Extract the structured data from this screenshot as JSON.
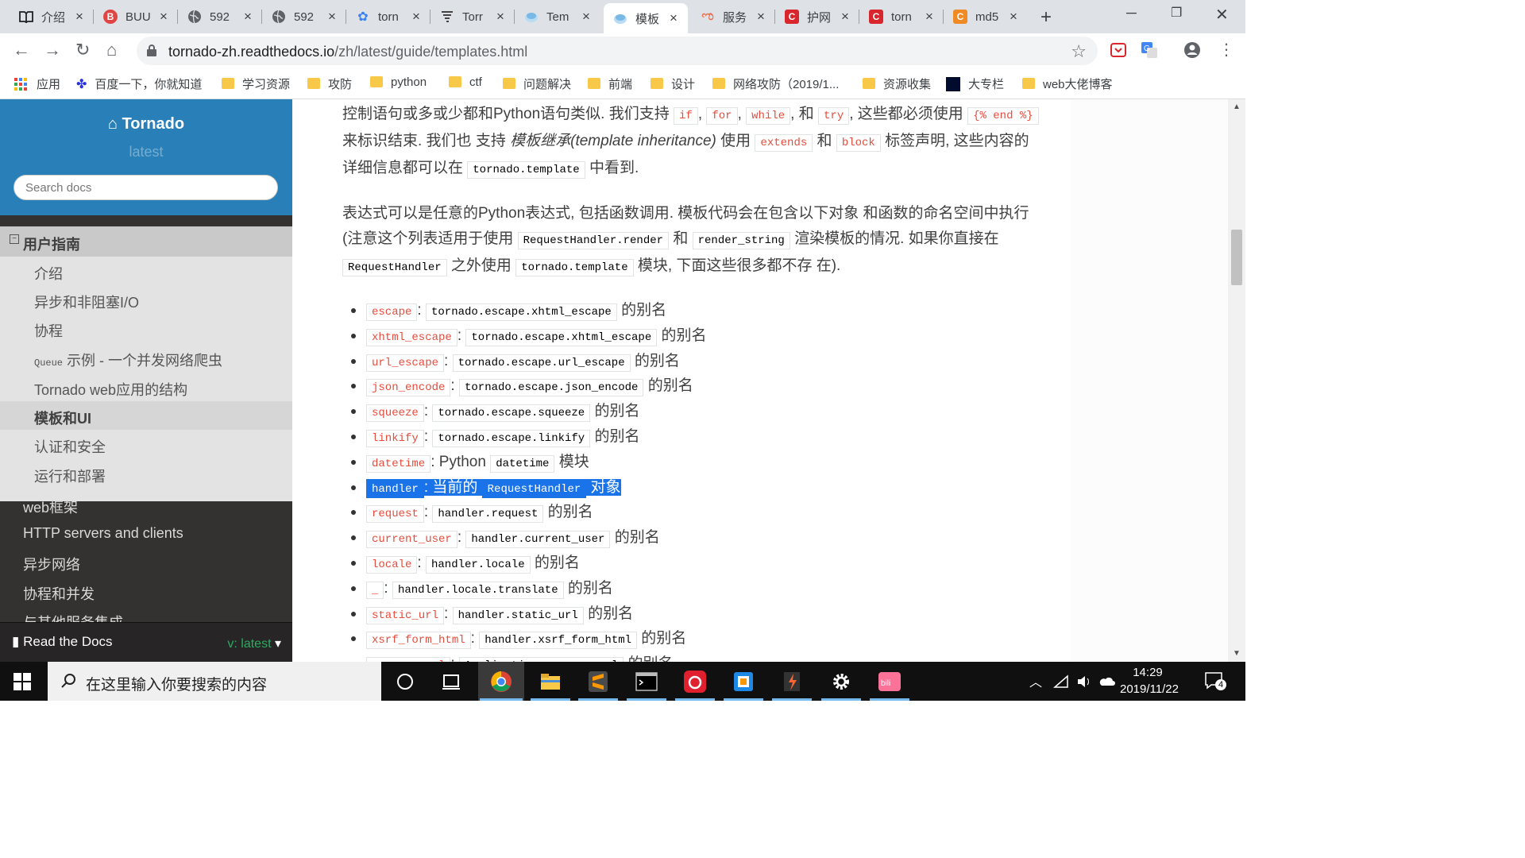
{
  "browser": {
    "tabs": [
      {
        "label": "介绍",
        "icon": "book-icon",
        "color": "#202124"
      },
      {
        "label": "BUU",
        "icon": "buu-logo-icon",
        "color": "#e04545"
      },
      {
        "label": "592",
        "icon": "globe-icon",
        "color": "#5f6368"
      },
      {
        "label": "592",
        "icon": "globe-icon",
        "color": "#5f6368"
      },
      {
        "label": "torn",
        "icon": "paw-icon",
        "color": "#3b82f6"
      },
      {
        "label": "Torr",
        "icon": "tornado-icon",
        "color": "#444444"
      },
      {
        "label": "Tem",
        "icon": "readthedocs-icon",
        "color": "#7ab8e6"
      },
      {
        "label": "模板",
        "icon": "readthedocs-icon",
        "color": "#7ab8e6",
        "active": true
      },
      {
        "label": "服务",
        "icon": "swirl-icon",
        "color": "#e86a4a"
      },
      {
        "label": "护网",
        "icon": "csdn-icon",
        "color": "#d9262c"
      },
      {
        "label": "torn",
        "icon": "csdn-icon",
        "color": "#d9262c"
      },
      {
        "label": "md5",
        "icon": "cmd5-icon",
        "color": "#f08a24"
      }
    ],
    "url_host": "tornado-zh.readthedocs.io",
    "url_path": "/zh/latest/guide/templates.html",
    "bookmarks": [
      {
        "label": "应用",
        "icon": "apps-grid-icon"
      },
      {
        "label": "百度一下，你就知道",
        "icon": "baidu-paw-icon"
      },
      {
        "label": "学习资源",
        "icon": "folder-icon"
      },
      {
        "label": "攻防",
        "icon": "folder-icon"
      },
      {
        "label": "python",
        "icon": "folder-icon"
      },
      {
        "label": "ctf",
        "icon": "folder-icon"
      },
      {
        "label": "问题解决",
        "icon": "folder-icon"
      },
      {
        "label": "前端",
        "icon": "folder-icon"
      },
      {
        "label": "设计",
        "icon": "folder-icon"
      },
      {
        "label": "网络攻防（2019/1...",
        "icon": "folder-icon"
      },
      {
        "label": "资源收集",
        "icon": "folder-icon"
      },
      {
        "label": "大专栏",
        "icon": "dazhuanlan-icon"
      },
      {
        "label": "web大佬博客",
        "icon": "folder-icon"
      }
    ]
  },
  "sidebar": {
    "title": "Tornado",
    "version": "latest",
    "search_placeholder": "Search docs",
    "current_section": "用户指南",
    "sub_items": [
      {
        "label": "介绍"
      },
      {
        "label": "异步和非阻塞I/O"
      },
      {
        "label": "协程"
      },
      {
        "prefix": "Queue",
        "label": " 示例 - 一个并发网络爬虫"
      },
      {
        "label": "Tornado web应用的结构"
      },
      {
        "label": "模板和UI",
        "current": true
      },
      {
        "label": "认证和安全"
      },
      {
        "label": "运行和部署"
      }
    ],
    "top_items": [
      "web框架",
      "HTTP servers and clients",
      "异步网络",
      "协程和并发",
      "与其他服务集成"
    ],
    "rtd_label": "Read the Docs",
    "rtd_version": "v: latest"
  },
  "content": {
    "p1": {
      "a": "控制语句或多或少都和Python语句类似. 我们支持 ",
      "c1": "if",
      "s1": ", ",
      "c2": "for",
      "s2": ", ",
      "c3": "while",
      "s3": ", 和 ",
      "c4": "try",
      "s4": ", 这些都必须使用 ",
      "c5": "{% end %}",
      "s5": " 来标识结束. 我们也 支持 ",
      "em": "模板继承(template inheritance)",
      "s6": " 使用 ",
      "c6": "extends",
      "s7": " 和 ",
      "c7": "block",
      "s8": " 标签声明, 这些内容的详细信息都可以在 ",
      "c8": "tornado.template",
      "s9": " 中看到."
    },
    "p2": {
      "a": "表达式可以是任意的Python表达式, 包括函数调用. 模板代码会在包含以下对象 和函数的命名空间中执行 (注意这个列表适用于使用 ",
      "c1": "RequestHandler.render",
      "s1": " 和 ",
      "c2": "render_string",
      "s2": " 渲染模板的情况. 如果你直接在 ",
      "c3": "RequestHandler",
      "s3": " 之外使用 ",
      "c4": "tornado.template",
      "s4": " 模块, 下面这些很多都不存 在)."
    },
    "items": [
      {
        "name": "escape",
        "sep": ": ",
        "target": "tornado.escape.xhtml_escape",
        "desc": " 的别名"
      },
      {
        "name": "xhtml_escape",
        "sep": ": ",
        "target": "tornado.escape.xhtml_escape",
        "desc": " 的别名"
      },
      {
        "name": "url_escape",
        "sep": ": ",
        "target": "tornado.escape.url_escape",
        "desc": " 的别名"
      },
      {
        "name": "json_encode",
        "sep": ": ",
        "target": "tornado.escape.json_encode",
        "desc": " 的别名"
      },
      {
        "name": "squeeze",
        "sep": ": ",
        "target": "tornado.escape.squeeze",
        "desc": " 的别名"
      },
      {
        "name": "linkify",
        "sep": ": ",
        "target": "tornado.escape.linkify",
        "desc": " 的别名"
      },
      {
        "name": "datetime",
        "sep": ": Python ",
        "target": "datetime",
        "desc": " 模块"
      },
      {
        "name": "handler",
        "sep": ": 当前的 ",
        "target": "RequestHandler",
        "desc": " 对象",
        "selected": true
      },
      {
        "name": "request",
        "sep": ": ",
        "target": "handler.request",
        "desc": " 的别名"
      },
      {
        "name": "current_user",
        "sep": ": ",
        "target": "handler.current_user",
        "desc": " 的别名"
      },
      {
        "name": "locale",
        "sep": ": ",
        "target": "handler.locale",
        "desc": " 的别名"
      },
      {
        "name": "_",
        "sep": ": ",
        "target": "handler.locale.translate",
        "desc": " 的别名"
      },
      {
        "name": "static_url",
        "sep": ": ",
        "target": "handler.static_url",
        "desc": " 的别名"
      },
      {
        "name": "xsrf_form_html",
        "sep": ": ",
        "target": "handler.xsrf_form_html",
        "desc": " 的别名"
      },
      {
        "name": "reverse_url",
        "sep": ": ",
        "target": "Application.reverse_url",
        "desc": " 的别名"
      }
    ]
  },
  "taskbar": {
    "search_placeholder": "在这里输入你要搜索的内容",
    "time": "14:29",
    "date": "2019/11/22",
    "notifications": "4",
    "apps": [
      "chrome-icon",
      "file-explorer-icon",
      "sublime-text-icon",
      "terminal-icon",
      "netease-music-icon",
      "virtualbox-icon",
      "burp-suite-icon",
      "settings-gear-icon",
      "bilibili-icon"
    ]
  },
  "colors": {
    "rtd_blue": "#2980b9",
    "sidebar_dark": "#343131",
    "literal_red": "#e74c3c",
    "selection_blue": "#1a73e8"
  }
}
